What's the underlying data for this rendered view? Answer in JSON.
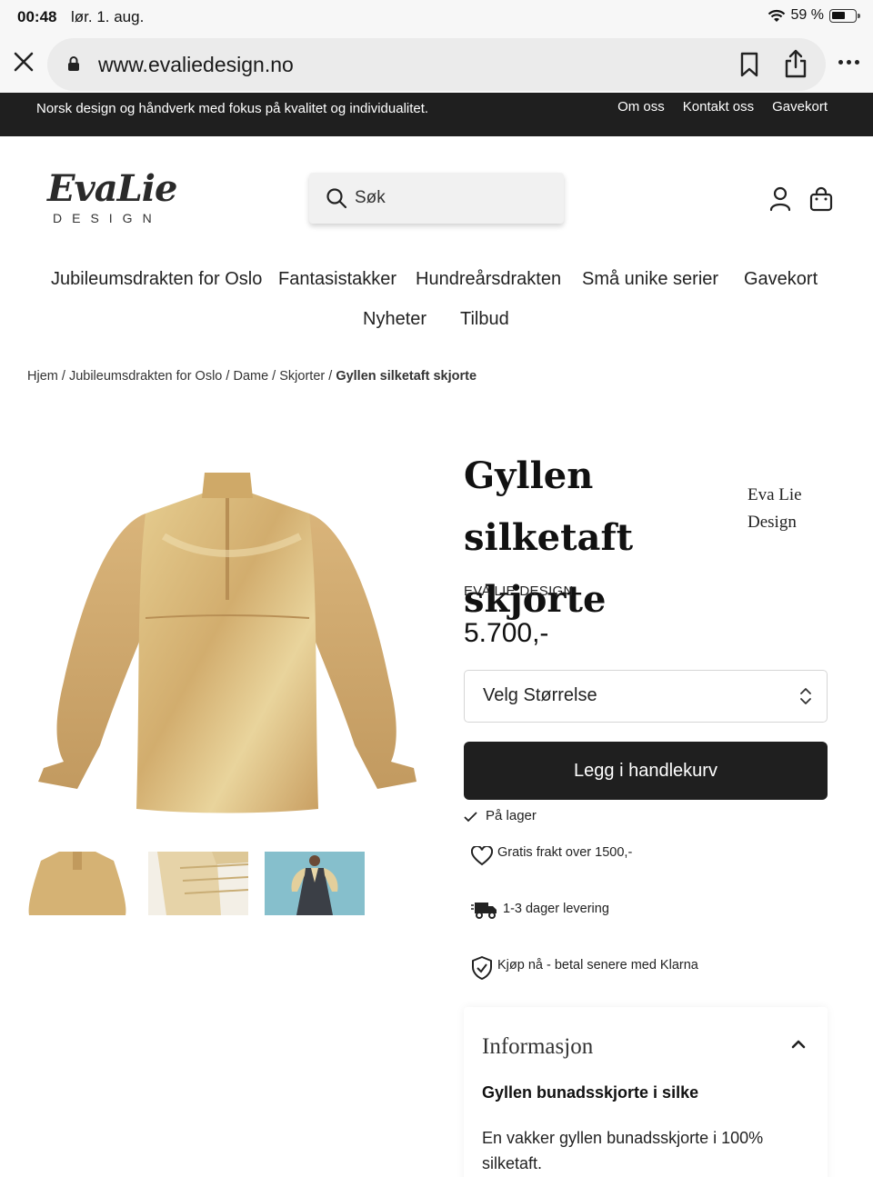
{
  "status_bar": {
    "time": "00:48",
    "date": "lør. 1. aug.",
    "battery": "59 %"
  },
  "browser": {
    "url": "www.evaliedesign.no"
  },
  "announcement": {
    "text": "Norsk design og håndverk med fokus på kvalitet og individualitet.",
    "links": [
      "Om oss",
      "Kontakt oss",
      "Gavekort"
    ]
  },
  "header": {
    "logo_script": "EvaLie",
    "logo_sub": "DESIGN",
    "search_placeholder": "Søk"
  },
  "nav": {
    "items": [
      "Jubileumsdrakten for Oslo",
      "Fantasistakker",
      "Hundreårsdrakten",
      "Små unike serier",
      "Gavekort",
      "Nyheter",
      "Tilbud"
    ]
  },
  "breadcrumb": {
    "items": [
      "Hjem",
      "Jubileumsdrakten for Oslo",
      "Dame",
      "Skjorter"
    ],
    "current": "Gyllen silketaft skjorte"
  },
  "product": {
    "title": "Gyllen silketaft skjorte",
    "vendor_side": "Eva Lie Design",
    "brand": "EVA LIE DESIGN",
    "price": "5.700,-",
    "size_select": "Velg Størrelse",
    "add_to_cart": "Legg i handlekurv",
    "stock": "På lager",
    "features": [
      {
        "icon": "heart-icon",
        "text": "Gratis frakt over 1500,-"
      },
      {
        "icon": "delivery-truck-icon",
        "text": "1-3 dager levering"
      },
      {
        "icon": "shield-check-icon",
        "text": "Kjøp nå - betal senere med Klarna"
      }
    ],
    "info": {
      "title": "Informasjon",
      "subtitle": "Gyllen bunadsskjorte i silke",
      "body": "En vakker gyllen bunadsskjorte i 100% silketaft."
    }
  },
  "colors": {
    "gold": "#d8b877",
    "dark": "#1f1f1f",
    "thumb_bg": "#7fb8c6"
  }
}
